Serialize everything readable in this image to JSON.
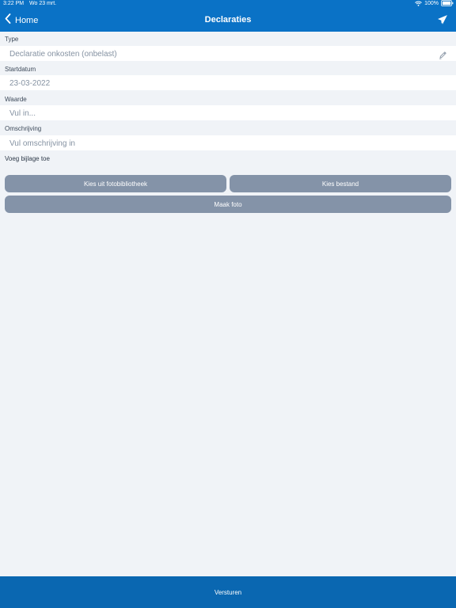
{
  "status_bar": {
    "time": "3:22 PM",
    "date": "Wo 23 mrt.",
    "battery": "100%"
  },
  "nav": {
    "back_label": "Home",
    "title": "Declaraties",
    "send_icon": "paper-plane-icon"
  },
  "form": {
    "type": {
      "label": "Type",
      "value": "Declaratie onkosten (onbelast)"
    },
    "startdatum": {
      "label": "Startdatum",
      "value": "23-03-2022"
    },
    "waarde": {
      "label": "Waarde",
      "placeholder": "Vul in..."
    },
    "omschrijving": {
      "label": "Omschrijving",
      "placeholder": "Vul omschrijving in"
    },
    "attachment": {
      "label": "Voeg bijlage toe"
    }
  },
  "buttons": {
    "photo_library": "Kies uit fotobibliotheek",
    "choose_file": "Kies bestand",
    "take_photo": "Maak foto"
  },
  "footer": {
    "submit_label": "Versturen"
  },
  "colors": {
    "primary": "#0a72c6",
    "footer": "#0a67b1",
    "button": "#8493a8",
    "background": "#f0f3f7"
  }
}
